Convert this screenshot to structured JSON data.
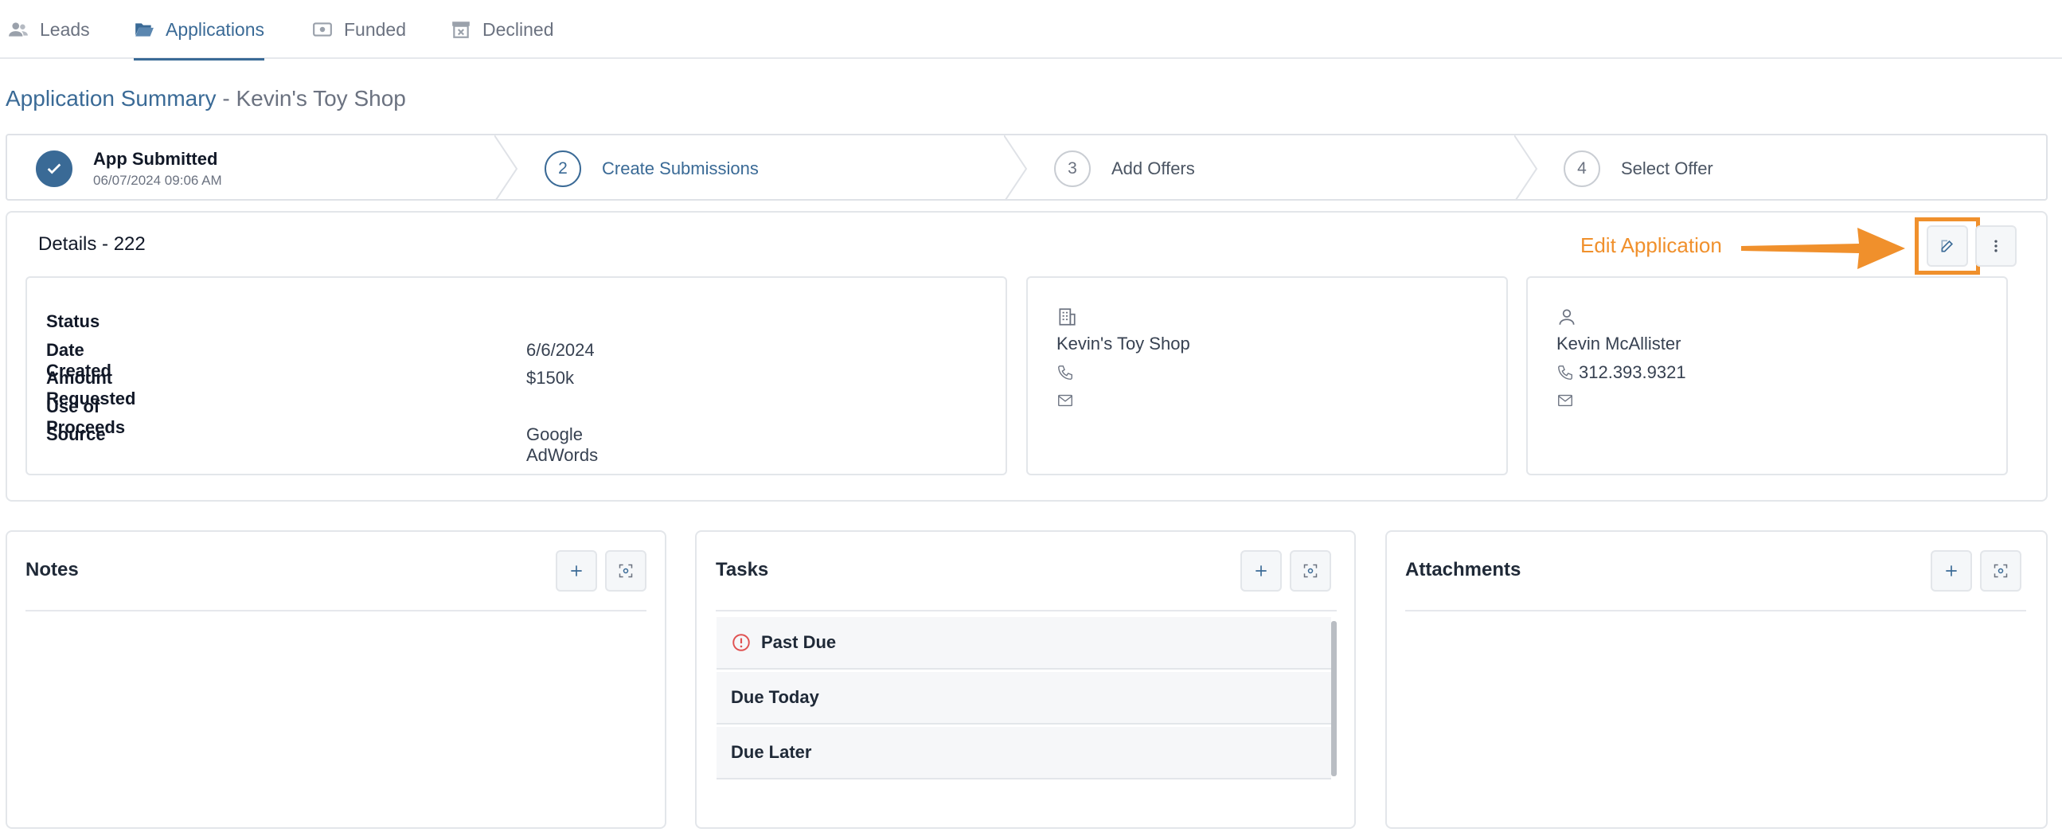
{
  "tabs": [
    {
      "label": "Leads",
      "icon": "users-icon",
      "active": false
    },
    {
      "label": "Applications",
      "icon": "folder-open-icon",
      "active": true
    },
    {
      "label": "Funded",
      "icon": "money-icon",
      "active": false
    },
    {
      "label": "Declined",
      "icon": "archive-x-icon",
      "active": false
    }
  ],
  "title": {
    "link": "Application Summary",
    "rest": " - Kevin's Toy Shop"
  },
  "stepper": {
    "steps": [
      {
        "number": "",
        "label": "App Submitted",
        "date": "06/07/2024 09:06 AM",
        "state": "done"
      },
      {
        "number": "2",
        "label": "Create Submissions",
        "state": "current"
      },
      {
        "number": "3",
        "label": "Add Offers",
        "state": "pending"
      },
      {
        "number": "4",
        "label": "Select Offer",
        "state": "pending"
      }
    ]
  },
  "details": {
    "title": "Details - 222",
    "fields": [
      {
        "label": "Status",
        "value": ""
      },
      {
        "label": "Date Created",
        "value": "6/6/2024"
      },
      {
        "label": "Amount Requested",
        "value": "$150k"
      },
      {
        "label": "Use of Proceeds",
        "value": ""
      },
      {
        "label": "Source",
        "value": "Google AdWords"
      }
    ],
    "business": {
      "name": "Kevin's Toy Shop",
      "phone": "",
      "email": ""
    },
    "contact": {
      "name": "Kevin McAllister",
      "phone": "312.393.9321",
      "email": ""
    }
  },
  "annotation": {
    "label": "Edit Application",
    "color": "#f0902c"
  },
  "notes": {
    "title": "Notes"
  },
  "tasks": {
    "title": "Tasks",
    "groups": [
      "Past Due",
      "Due Today",
      "Due Later"
    ]
  },
  "attachments": {
    "title": "Attachments"
  },
  "colors": {
    "accent": "#3a6a96",
    "annotation": "#f0902c",
    "danger": "#e05252"
  }
}
